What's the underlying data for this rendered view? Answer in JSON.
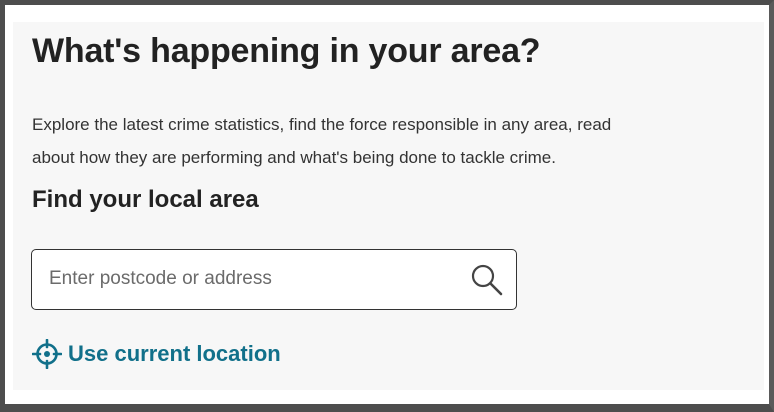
{
  "header": {
    "title": "What's happening in your area?"
  },
  "intro": {
    "text": "Explore the latest crime statistics, find the force responsible in any area, read\nabout how they are performing and what's being done to tackle crime."
  },
  "search": {
    "heading": "Find your local area",
    "placeholder": "Enter postcode or address",
    "value": "",
    "button_icon": "search-icon"
  },
  "location": {
    "label": "Use current location",
    "icon": "crosshair-icon"
  },
  "colors": {
    "link": "#11708a",
    "heading": "#222222",
    "panel_background": "#f7f7f7",
    "frame": "#4d4d4d"
  }
}
